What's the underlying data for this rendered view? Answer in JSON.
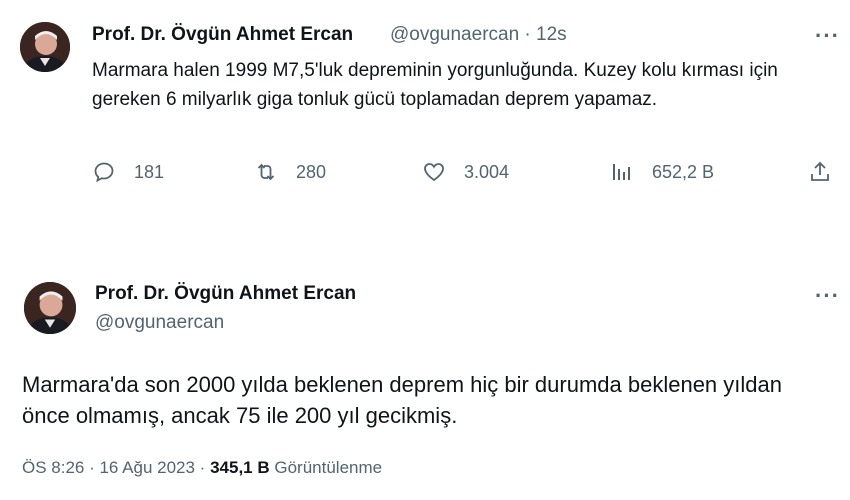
{
  "tweet1": {
    "display_name": "Prof. Dr. Övgün Ahmet Ercan",
    "handle_time": "@ovgunaercan · 12s",
    "text": "Marmara halen 1999 M7,5'luk depreminin yorgunluğunda. Kuzey kolu kırması için gereken 6 milyarlık giga tonluk gücü toplamadan deprem yapamaz.",
    "replies": "181",
    "retweets": "280",
    "likes": "3.004",
    "views": "652,2 B",
    "more_icon": "ellipsis-icon"
  },
  "tweet2": {
    "display_name": "Prof. Dr. Övgün Ahmet Ercan",
    "handle": "@ovgunaercan",
    "text": "Marmara'da son 2000 yılda beklenen deprem hiç bir durumda beklenen yıldan önce olmamış, ancak 75 ile 200 yıl gecikmiş.",
    "timestamp": "ÖS 8:26 · 16 Ağu 2023 ·",
    "view_count": "345,1 B",
    "views_label": "Görüntülenme"
  },
  "colors": {
    "text": "#0f1419",
    "secondary": "#536471"
  }
}
